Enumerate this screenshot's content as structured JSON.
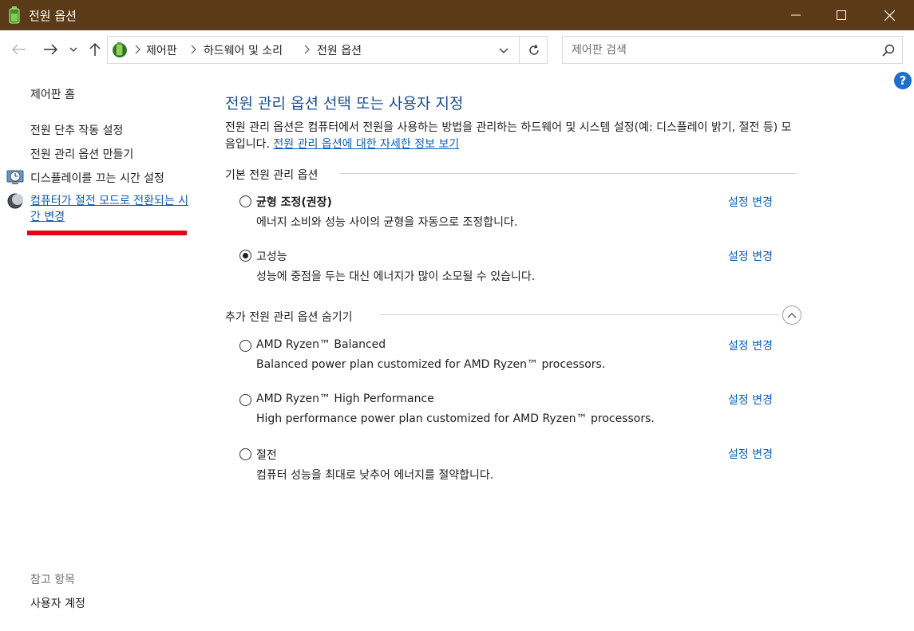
{
  "window": {
    "title": "전원 옵션",
    "colors": {
      "titlebar": "#5b3a17",
      "link": "#0b5fb5",
      "heading": "#1a4f99",
      "annotation": "#e60012"
    }
  },
  "address": {
    "breadcrumbs": [
      "제어판",
      "하드웨어 및 소리",
      "전원 옵션"
    ]
  },
  "search": {
    "placeholder": "제어판 검색"
  },
  "help": {
    "label": "?"
  },
  "sidebar": {
    "home": "제어판 홈",
    "items": [
      {
        "label": "전원 단추 작동 설정",
        "icon": "none"
      },
      {
        "label": "전원 관리 옵션 만들기",
        "icon": "none"
      },
      {
        "label": "디스플레이를 끄는 시간 설정",
        "icon": "display-clock-icon"
      },
      {
        "label": "컴퓨터가 절전 모드로 전환되는 시간 변경",
        "icon": "moon-icon"
      }
    ],
    "see_also_title": "참고 항목",
    "see_also_items": [
      "사용자 계정"
    ]
  },
  "main": {
    "title": "전원 관리 옵션 선택 또는 사용자 지정",
    "description": "전원 관리 옵션은 컴퓨터에서 전원을 사용하는 방법을 관리하는 하드웨어 및 시스템 설정(예: 디스플레이 밝기, 절전 등) 모음입니다. ",
    "description_link": "전원 관리 옵션에 대한 자세한 정보 보기",
    "preferred_section": "기본 전원 관리 옵션",
    "hidden_section": "추가 전원 관리 옵션 숨기기",
    "change_label": "설정 변경",
    "preferred_plans": [
      {
        "name": "균형 조정(권장)",
        "desc": "에너지 소비와 성능 사이의 균형을 자동으로 조정합니다.",
        "selected": false,
        "bold": true
      },
      {
        "name": "고성능",
        "desc": "성능에 중점을 두는 대신 에너지가 많이 소모될 수 있습니다.",
        "selected": true,
        "bold": false
      }
    ],
    "additional_plans": [
      {
        "name": "AMD Ryzen™ Balanced",
        "desc": "Balanced power plan customized for AMD Ryzen™ processors.",
        "selected": false
      },
      {
        "name": "AMD Ryzen™ High Performance",
        "desc": "High performance power plan customized for AMD Ryzen™ processors.",
        "selected": false
      },
      {
        "name": "절전",
        "desc": "컴퓨터 성능을 최대로 낮추어 에너지를 절약합니다.",
        "selected": false
      }
    ]
  }
}
